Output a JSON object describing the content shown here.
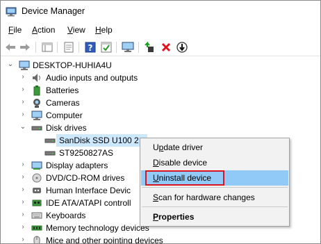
{
  "window": {
    "title": "Device Manager"
  },
  "menu": {
    "items": [
      {
        "id": "file",
        "accel": "F",
        "rest": "ile"
      },
      {
        "id": "action",
        "accel": "A",
        "rest": "ction"
      },
      {
        "id": "view",
        "accel": "V",
        "rest": "iew"
      },
      {
        "id": "help",
        "accel": "H",
        "rest": "elp"
      }
    ]
  },
  "toolbar": {
    "buttons": [
      "back-icon",
      "forward-icon",
      "show-hide-console-tree-icon",
      "properties-icon",
      "help-icon",
      "action-pane-icon",
      "monitor-icon",
      "update-driver-icon",
      "uninstall-icon",
      "scan-hardware-icon"
    ]
  },
  "tree": {
    "root": "DESKTOP-HUHIA4U",
    "nodes": [
      {
        "label": "Audio inputs and outputs",
        "expanded": false
      },
      {
        "label": "Batteries",
        "expanded": false
      },
      {
        "label": "Cameras",
        "expanded": false
      },
      {
        "label": "Computer",
        "expanded": false
      },
      {
        "label": "Disk drives",
        "expanded": true
      },
      {
        "label": "SanDisk SSD U100 2",
        "child": true,
        "selected": true
      },
      {
        "label": "ST9250827AS",
        "child": true
      },
      {
        "label": "Display adapters",
        "expanded": false
      },
      {
        "label": "DVD/CD-ROM drives",
        "expanded": false
      },
      {
        "label": "Human Interface Devic",
        "expanded": false
      },
      {
        "label": "IDE ATA/ATAPI controll",
        "expanded": false
      },
      {
        "label": "Keyboards",
        "expanded": false
      },
      {
        "label": "Memory technology devices",
        "expanded": false
      },
      {
        "label": "Mice and other pointing devices",
        "expanded": false
      }
    ]
  },
  "context_menu": {
    "update_driver": {
      "pre": "U",
      "accel": "p",
      "post": "date driver"
    },
    "disable_device": {
      "pre": "",
      "accel": "D",
      "post": "isable device"
    },
    "uninstall_device": {
      "pre": "",
      "accel": "U",
      "post": "ninstall device"
    },
    "scan": {
      "pre": "",
      "accel": "S",
      "post": "can for hardware changes"
    },
    "properties": {
      "pre": "",
      "accel": "P",
      "post": "roperties"
    }
  },
  "colors": {
    "highlight": "#91c9f7",
    "selection": "#cce8ff",
    "callout": "#d6151f",
    "uninstall_red": "#e0141e"
  }
}
